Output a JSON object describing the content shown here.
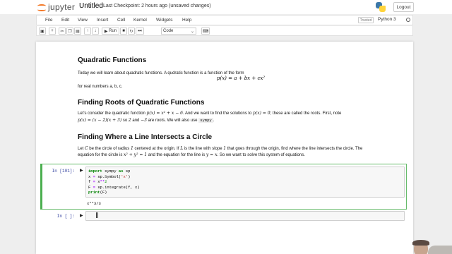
{
  "header": {
    "logo_text": "jupyter",
    "notebook_name": "Untitled",
    "checkpoint": "Last Checkpoint: 2 hours ago  (unsaved changes)",
    "logout": "Logout"
  },
  "menubar": {
    "items": [
      "File",
      "Edit",
      "View",
      "Insert",
      "Cell",
      "Kernel",
      "Widgets",
      "Help"
    ],
    "trusted": "Trusted",
    "kernel": "Python 3"
  },
  "toolbar": {
    "run_label": "Run",
    "cell_type": "Code",
    "buttons": [
      "save-icon",
      "plus-icon",
      "cut-icon",
      "copy-icon",
      "paste-icon",
      "arrow-up-icon",
      "arrow-down-icon",
      "run-icon",
      "stop-icon",
      "restart-icon",
      "fast-forward-icon",
      "keyboard-icon"
    ]
  },
  "markdown": {
    "h1_quadratic": "Quadratic Functions",
    "p_intro": "Today we will learn about quadratic functions. A qudratic function is a function of the form",
    "display_formula": "p(x) = a + bx + cx²",
    "p_reals": "for real numbers a, b, c.",
    "h1_roots": "Finding Roots of Quadratic Functions",
    "roots_line1_a": "Let's consider the quadratic function ",
    "roots_line1_math": "p(x) = x² + x − 6",
    "roots_line1_b": ". And we want to find the solutions to ",
    "roots_line1_math2": "p(x) = 0",
    "roots_line1_c": "; these are called the roots. First, note",
    "roots_line2_math": "p(x) = (x − 2)(x + 3)",
    "roots_line2_a": " so ",
    "roots_line2_m1": "2",
    "roots_line2_b": " and ",
    "roots_line2_m2": "−3",
    "roots_line2_c": " are roots. We will also use ",
    "roots_line2_code": "sympy",
    "roots_line2_d": ".",
    "h1_circle": "Finding Where a Line Intersects a Circle",
    "circle_line1_a": "Let ",
    "circle_line1_C": "C",
    "circle_line1_b": " be the circle of radius ",
    "circle_line1_r": "1",
    "circle_line1_c": " centered at the origin. If ",
    "circle_line1_L": "L",
    "circle_line1_d": " is the line with slope ",
    "circle_line1_s": "1",
    "circle_line1_e": " that goes through the origin, find where the line intersects the circle. The",
    "circle_line2_a": "equation for the circle is ",
    "circle_line2_m": "x² + y² = 1",
    "circle_line2_b": " and the equation for the line is ",
    "circle_line2_m2": "y = x",
    "circle_line2_c": ". So we want to solve this system of equations."
  },
  "cells": {
    "cell1_prompt": "In [101]:",
    "cell1_code": [
      "import sympy as sp",
      "x = sp.Symbol('x')",
      "f = x**2",
      "F = sp.integrate(f, x)",
      "print(F)"
    ],
    "cell1_output": "x**3/3",
    "cell2_prompt": "In [ ]:",
    "cell2_code": ""
  }
}
